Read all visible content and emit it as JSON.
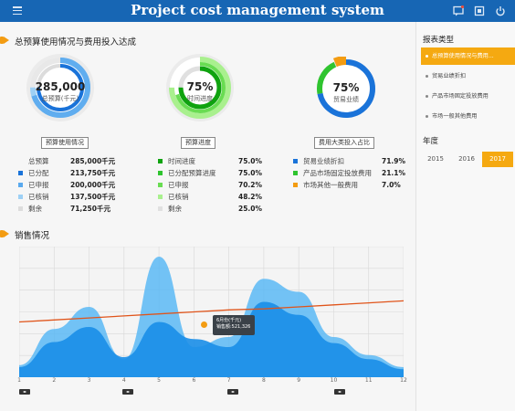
{
  "header": {
    "title": "Project cost management system",
    "icons": [
      "menu-icon",
      "message-icon",
      "fullscreen-icon",
      "power-icon"
    ]
  },
  "section1": {
    "title": "总预算使用情况与费用投入达成"
  },
  "donuts": [
    {
      "value": "285,000",
      "sub": "总预算(千元)",
      "button": "预算使用情况"
    },
    {
      "value": "75%",
      "sub": "时间进度",
      "button": "预算进度"
    },
    {
      "value": "75%",
      "sub": "贸易业绩",
      "button": "费用大类投入占比"
    }
  ],
  "legend1": [
    {
      "name": "总预算",
      "value": "285,000千元",
      "color": ""
    },
    {
      "name": "已分配",
      "value": "213,750千元",
      "color": "#1a73d9"
    },
    {
      "name": "已申报",
      "value": "200,000千元",
      "color": "#5aa9ee"
    },
    {
      "name": "已核销",
      "value": "137,500千元",
      "color": "#9dd0f5"
    },
    {
      "name": "剩余",
      "value": "71,250千元",
      "color": "#dcdcdc"
    }
  ],
  "legend2": [
    {
      "name": "时间进度",
      "value": "75.0%",
      "color": "#0fa30f"
    },
    {
      "name": "已分配预算进度",
      "value": "75.0%",
      "color": "#2fc42f"
    },
    {
      "name": "已申报",
      "value": "70.2%",
      "color": "#69dc52"
    },
    {
      "name": "已核销",
      "value": "48.2%",
      "color": "#a9f08e"
    },
    {
      "name": "剩余",
      "value": "25.0%",
      "color": "#e0e0e0"
    }
  ],
  "legend3": [
    {
      "name": "贸易业绩折扣",
      "value": "71.9%",
      "color": "#1a73d9"
    },
    {
      "name": "产品市场固定投放费用",
      "value": "21.1%",
      "color": "#2fc42f"
    },
    {
      "name": "市场其他一般费用",
      "value": "7.0%",
      "color": "#f39c12"
    }
  ],
  "section2": {
    "title": "销售情况"
  },
  "tooltip": {
    "line1": "6月份(千元)",
    "line2": "销售额:521,326"
  },
  "chart_data": {
    "type": "area",
    "x": [
      "1",
      "2",
      "3",
      "4",
      "5",
      "6",
      "7",
      "8",
      "9",
      "10",
      "11",
      "12"
    ],
    "series": [
      {
        "values": [
          12,
          48,
          70,
          18,
          120,
          30,
          40,
          98,
          85,
          40,
          22,
          10
        ],
        "color": "#5ab8f5"
      },
      {
        "values": [
          10,
          35,
          50,
          20,
          55,
          38,
          30,
          75,
          62,
          34,
          18,
          8
        ],
        "color": "#1a8ee8"
      }
    ],
    "trend": {
      "values": [
        55,
        57,
        59,
        61,
        63,
        65,
        67,
        68,
        70,
        72,
        74,
        76
      ],
      "color": "#e0541a"
    },
    "ylim": [
      0,
      130
    ],
    "grid": true
  },
  "sidebar": {
    "title": "报表类型",
    "items": [
      {
        "label": "总预算使用情况与费用...",
        "active": true
      },
      {
        "label": "贸易业绩折扣",
        "active": false
      },
      {
        "label": "产品市场固定投放费用",
        "active": false
      },
      {
        "label": "市场一般其他费用",
        "active": false
      }
    ],
    "year_title": "年度",
    "years": [
      "2015",
      "2016",
      "2017"
    ],
    "active_year": "2017"
  }
}
